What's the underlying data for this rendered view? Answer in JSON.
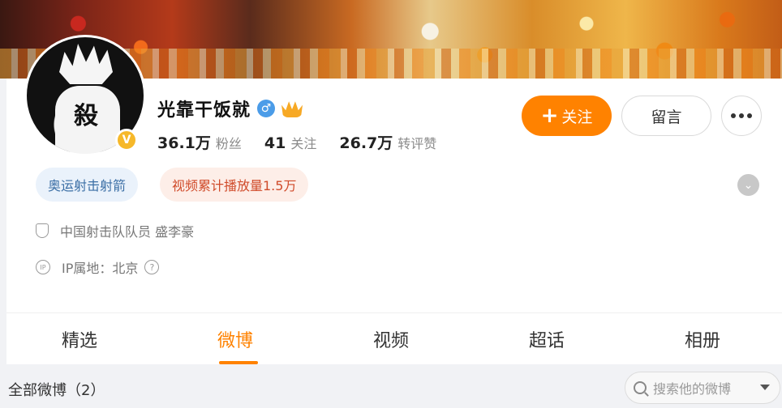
{
  "profile": {
    "name": "光靠干饭就",
    "gender_icon": "♂",
    "avatar_glyph": "殺",
    "verified_mark": "V",
    "stats": [
      {
        "value": "36.1万",
        "label": "粉丝"
      },
      {
        "value": "41",
        "label": "关注"
      },
      {
        "value": "26.7万",
        "label": "转评赞"
      }
    ],
    "tags": [
      "奥运射击射箭",
      "视频累计播放量1.5万"
    ],
    "bio": "中国射击队队员 盛李豪",
    "ip": "IP属地：北京",
    "info_icon_ip": "IP"
  },
  "actions": {
    "follow_plus": "+",
    "follow_label": "关注",
    "message_label": "留言",
    "expand_glyph": "⌄",
    "help_glyph": "?"
  },
  "tabs": [
    "精选",
    "微博",
    "视频",
    "超话",
    "相册"
  ],
  "active_tab": "微博",
  "feed": {
    "all_posts_label": "全部微博（2）",
    "search_placeholder": "搜索他的微博"
  },
  "colors": {
    "accent": "#ff8200",
    "gender_blue": "#4b9ce8",
    "verified_gold": "#f6b82a"
  }
}
